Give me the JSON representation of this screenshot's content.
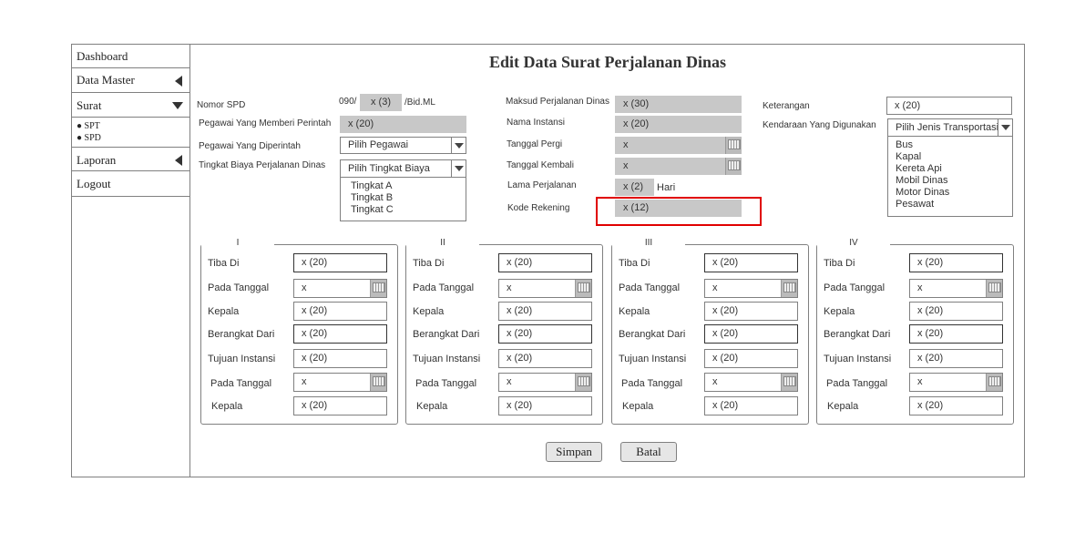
{
  "sidebar": {
    "items": [
      {
        "label": "Dashboard"
      },
      {
        "label": "Data Master"
      },
      {
        "label": "Surat"
      },
      {
        "label": "Laporan"
      },
      {
        "label": "Logout"
      }
    ],
    "subitems": [
      "SPT",
      "SPD"
    ]
  },
  "page_title": "Edit Data Surat Perjalanan Dinas",
  "form": {
    "nomor_spd": {
      "label": "Nomor SPD",
      "prefix": "090/",
      "value": "x (3)",
      "suffix": "/Bid.ML"
    },
    "pegawai_pemberi": {
      "label": "Pegawai Yang Memberi Perintah",
      "value": "x (20)"
    },
    "pegawai_diperintah": {
      "label": "Pegawai Yang Diperintah",
      "value": "Pilih Pegawai"
    },
    "tingkat_biaya": {
      "label": "Tingkat Biaya Perjalanan Dinas",
      "value": "Pilih Tingkat Biaya",
      "options": [
        "Tingkat A",
        "Tingkat B",
        "Tingkat C"
      ]
    },
    "maksud": {
      "label": "Maksud Perjalanan Dinas",
      "value": "x (30)"
    },
    "nama_instansi": {
      "label": "Nama Instansi",
      "value": "x (20)"
    },
    "tanggal_pergi": {
      "label": "Tanggal Pergi",
      "value": "x"
    },
    "tanggal_kembali": {
      "label": "Tanggal Kembali",
      "value": "x"
    },
    "lama": {
      "label": "Lama Perjalanan",
      "value": "x (2)",
      "unit": "Hari"
    },
    "kode_rekening": {
      "label": "Kode Rekening",
      "value": "x (12)"
    },
    "keterangan": {
      "label": "Keterangan",
      "value": "x (20)"
    },
    "kendaraan": {
      "label": "Kendaraan Yang Digunakan",
      "value": "Pilih Jenis Transportasi",
      "options": [
        "Bus",
        "Kapal",
        "Kereta Api",
        "Mobil Dinas",
        "Motor Dinas",
        "Pesawat"
      ]
    }
  },
  "panels": [
    {
      "title": "I",
      "tiba_label": "Tiba Di",
      "tiba": "x (20)",
      "tgl1_label": "Pada Tanggal",
      "tgl1": "x",
      "kepala1_label": "Kepala",
      "kepala1": "x (20)",
      "berangkat_label": "Berangkat Dari",
      "berangkat": "x (20)",
      "tujuan_label": "Tujuan Instansi",
      "tujuan": "x (20)",
      "tgl2_label": "Pada Tanggal",
      "tgl2": "x",
      "kepala2_label": "Kepala",
      "kepala2": "x (20)"
    },
    {
      "title": "II",
      "tiba_label": "Tiba Di",
      "tiba": "x (20)",
      "tgl1_label": "Pada Tanggal",
      "tgl1": "x",
      "kepala1_label": "Kepala",
      "kepala1": "x (20)",
      "berangkat_label": "Berangkat Dari",
      "berangkat": "x (20)",
      "tujuan_label": "Tujuan Instansi",
      "tujuan": "x (20)",
      "tgl2_label": "Pada Tanggal",
      "tgl2": "x",
      "kepala2_label": "Kepala",
      "kepala2": "x (20)"
    },
    {
      "title": "III",
      "tiba_label": "Tiba Di",
      "tiba": "x (20)",
      "tgl1_label": "Pada Tanggal",
      "tgl1": "x",
      "kepala1_label": "Kepala",
      "kepala1": "x (20)",
      "berangkat_label": "Berangkat Dari",
      "berangkat": "x (20)",
      "tujuan_label": "Tujuan Instansi",
      "tujuan": "x (20)",
      "tgl2_label": "Pada Tanggal",
      "tgl2": "x",
      "kepala2_label": "Kepala",
      "kepala2": "x (20)"
    },
    {
      "title": "IV",
      "tiba_label": "Tiba Di",
      "tiba": "x (20)",
      "tgl1_label": "Pada Tanggal",
      "tgl1": "x",
      "kepala1_label": "Kepala",
      "kepala1": "x (20)",
      "berangkat_label": "Berangkat Dari",
      "berangkat": "x (20)",
      "tujuan_label": "Tujuan Instansi",
      "tujuan": "x (20)",
      "tgl2_label": "Pada Tanggal",
      "tgl2": "x",
      "kepala2_label": "Kepala",
      "kepala2": "x (20)"
    }
  ],
  "buttons": {
    "simpan": "Simpan",
    "batal": "Batal"
  },
  "colors": {
    "highlight": "#e00000",
    "field_gray": "#c8c8c8"
  }
}
